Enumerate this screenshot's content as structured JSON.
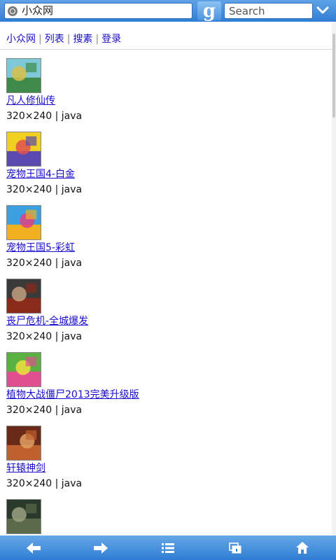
{
  "browser": {
    "url_value": "小众网",
    "search_logo": "g",
    "search_placeholder": "Search",
    "accent": "#2f7dd3"
  },
  "nav": {
    "links": [
      "小众网",
      "列表",
      "搜素",
      "登录"
    ],
    "separator": "|"
  },
  "items": [
    {
      "title": "凡人修仙传",
      "meta": "320×240 | java",
      "thumb_colors": [
        "#7ec8d8",
        "#3e8a4a",
        "#d9c04a"
      ]
    },
    {
      "title": "宠物王国4-白金",
      "meta": "320×240 | java",
      "thumb_colors": [
        "#f0d020",
        "#5a4ab0",
        "#e05050"
      ]
    },
    {
      "title": "宠物王国5-彩虹",
      "meta": "320×240 | java",
      "thumb_colors": [
        "#3aa0e0",
        "#f0b020",
        "#e04080"
      ]
    },
    {
      "title": "丧尸危机-全城爆发",
      "meta": "320×240 | java",
      "thumb_colors": [
        "#3a3a3a",
        "#8a2a1a",
        "#c0a080"
      ]
    },
    {
      "title": "植物大战僵尸2013完美升级版",
      "meta": "320×240 | java",
      "thumb_colors": [
        "#5ab040",
        "#e05090",
        "#f0e040"
      ]
    },
    {
      "title": "轩辕神剑",
      "meta": "320×240 | java",
      "thumb_colors": [
        "#6a2a1a",
        "#c06030",
        "#e0a060"
      ]
    },
    {
      "title": "",
      "meta": "",
      "thumb_colors": [
        "#2a3a2a",
        "#5a6a4a",
        "#9aa080"
      ]
    }
  ],
  "toolbar": {
    "icons": [
      "back-arrow-icon",
      "forward-arrow-icon",
      "menu-list-icon",
      "windows-icon",
      "home-icon"
    ]
  }
}
